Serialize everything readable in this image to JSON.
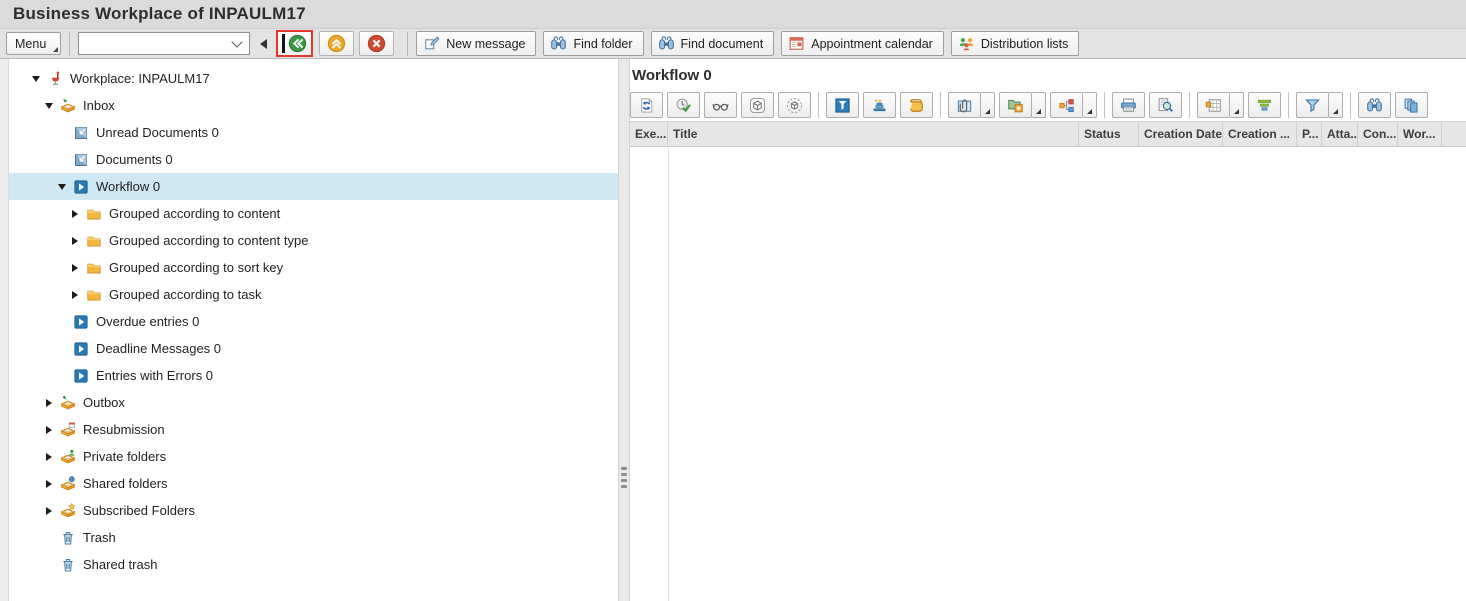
{
  "window": {
    "title": "Business Workplace of INPAULM17"
  },
  "main_toolbar": {
    "menu_label": "Menu",
    "command_field": {
      "value": "",
      "placeholder": ""
    },
    "nav_buttons": [
      {
        "name": "back",
        "icon": "back-circle",
        "highlighted": true
      },
      {
        "name": "exit",
        "icon": "exit-circle",
        "highlighted": false
      },
      {
        "name": "cancel",
        "icon": "cancel-circle",
        "highlighted": false
      }
    ],
    "app_buttons": [
      {
        "label": "New message",
        "icon": "new-message"
      },
      {
        "label": "Find folder",
        "icon": "binoculars"
      },
      {
        "label": "Find document",
        "icon": "binoculars"
      },
      {
        "label": "Appointment calendar",
        "icon": "appointment-calendar"
      },
      {
        "label": "Distribution lists",
        "icon": "distribution-lists"
      }
    ]
  },
  "tree": {
    "items": [
      {
        "label": "Workplace: INPAULM17",
        "level": 0,
        "expander": "expanded",
        "icon": "workplace",
        "selected": false
      },
      {
        "label": "Inbox",
        "level": 1,
        "expander": "expanded",
        "icon": "inbox",
        "selected": false
      },
      {
        "label": "Unread Documents 0",
        "level": 2,
        "expander": "none",
        "icon": "document",
        "selected": false
      },
      {
        "label": "Documents 0",
        "level": 2,
        "expander": "none",
        "icon": "document",
        "selected": false
      },
      {
        "label": "Workflow 0",
        "level": 2,
        "expander": "expanded",
        "icon": "workflow",
        "selected": true
      },
      {
        "label": "Grouped according to content",
        "level": 3,
        "expander": "collapsed",
        "icon": "folder",
        "selected": false
      },
      {
        "label": "Grouped according to content type",
        "level": 3,
        "expander": "collapsed",
        "icon": "folder",
        "selected": false
      },
      {
        "label": "Grouped according to sort key",
        "level": 3,
        "expander": "collapsed",
        "icon": "folder",
        "selected": false
      },
      {
        "label": "Grouped according to task",
        "level": 3,
        "expander": "collapsed",
        "icon": "folder",
        "selected": false
      },
      {
        "label": "Overdue entries 0",
        "level": 2,
        "expander": "none",
        "icon": "workflow",
        "selected": false
      },
      {
        "label": "Deadline Messages 0",
        "level": 2,
        "expander": "none",
        "icon": "workflow",
        "selected": false
      },
      {
        "label": "Entries with Errors 0",
        "level": 2,
        "expander": "none",
        "icon": "workflow",
        "selected": false
      },
      {
        "label": "Outbox",
        "level": 1,
        "expander": "collapsed",
        "icon": "outbox",
        "selected": false
      },
      {
        "label": "Resubmission",
        "level": 1,
        "expander": "collapsed",
        "icon": "resubmission",
        "selected": false
      },
      {
        "label": "Private folders",
        "level": 1,
        "expander": "collapsed",
        "icon": "private-folders",
        "selected": false
      },
      {
        "label": "Shared folders",
        "level": 1,
        "expander": "collapsed",
        "icon": "shared-folders",
        "selected": false
      },
      {
        "label": "Subscribed Folders",
        "level": 1,
        "expander": "collapsed",
        "icon": "subscribed-folders",
        "selected": false
      },
      {
        "label": "Trash",
        "level": 1,
        "expander": "none",
        "icon": "trash",
        "selected": false
      },
      {
        "label": "Shared trash",
        "level": 1,
        "expander": "none",
        "icon": "trash",
        "selected": false
      }
    ]
  },
  "workflow_panel": {
    "title": "Workflow 0",
    "toolbar_groups": [
      [
        {
          "icon": "refresh"
        },
        {
          "icon": "execute"
        },
        {
          "icon": "glasses"
        },
        {
          "icon": "object-cube"
        },
        {
          "icon": "object-cube-dotted"
        }
      ],
      [
        {
          "icon": "work-item"
        },
        {
          "icon": "workflow-overview"
        },
        {
          "icon": "workflow-log"
        }
      ],
      [
        {
          "icon": "attachment",
          "dropdown": true
        },
        {
          "icon": "create-folder",
          "dropdown": true
        },
        {
          "icon": "organization",
          "dropdown": true
        }
      ],
      [
        {
          "icon": "print"
        },
        {
          "icon": "print-preview"
        }
      ],
      [
        {
          "icon": "table-settings",
          "dropdown": true
        },
        {
          "icon": "sort"
        }
      ],
      [
        {
          "icon": "filter",
          "dropdown": true
        }
      ],
      [
        {
          "icon": "binoculars"
        },
        {
          "icon": "views"
        }
      ]
    ],
    "columns": [
      "Exe...",
      "Title",
      "Status",
      "Creation Date",
      "Creation ...",
      "P...",
      "Atta...",
      "Con...",
      "Wor..."
    ],
    "rows": []
  },
  "icon_glossary": {
    "back-circle": "green circle, white double left chevron",
    "exit-circle": "orange circle, white double up chevron",
    "cancel-circle": "red circle, white X",
    "workplace": "red office chair",
    "inbox": "orange tray, green inbound arrow",
    "outbox": "orange tray, green outbound arrow",
    "document": "blue square, white inbound arrow",
    "workflow": "blue square, white play triangle",
    "folder": "yellow folder",
    "resubmission": "orange tray, calendar badge",
    "private-folders": "orange tray, person badge",
    "shared-folders": "orange tray, globe badge",
    "subscribed-folders": "orange tray, star badge",
    "trash": "blue trash can",
    "refresh": "document with blue circular arrows",
    "execute": "clock with green check",
    "glasses": "spectacles",
    "object-cube": "cube in rounded square",
    "object-cube-dotted": "cube in dotted circle",
    "work-item": "white funnel on blue square",
    "workflow-overview": "stacked blue discs with orange dashed line",
    "workflow-log": "orange scroll",
    "attachment": "paperclip on blue note",
    "create-folder": "green folder with orange plus tile",
    "organization": "linked colored squares",
    "print": "blue printer",
    "print-preview": "magnifier over page",
    "table-settings": "grid with orange cell",
    "sort": "descending green/blue bars",
    "filter": "blue funnel",
    "binoculars": "blue binoculars",
    "views": "cascaded blue panes"
  },
  "colors": {
    "selection": "#cfe8f4",
    "highlight_box": "#e0392b",
    "titlebar_bg": "#dbdbdb",
    "toolbar_bg": "#e3e3e3",
    "header_row_bg": "#e6e6e6"
  }
}
